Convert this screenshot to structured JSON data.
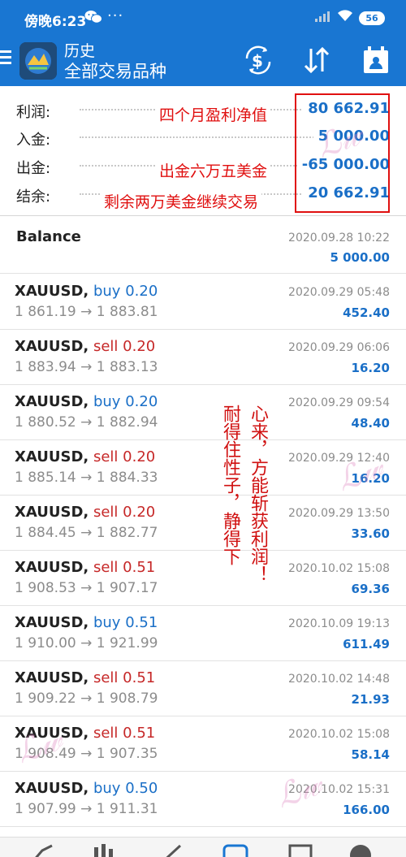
{
  "status_bar": {
    "time": "傍晚6:23",
    "dots": "···",
    "battery": "56"
  },
  "app_bar": {
    "title": "历史",
    "subtitle": "全部交易品种"
  },
  "summary": [
    {
      "label": "利润:",
      "value": "80 662.91"
    },
    {
      "label": "入金:",
      "value": "5 000.00"
    },
    {
      "label": "出金:",
      "value": "-65 000.00"
    },
    {
      "label": "结余:",
      "value": "20 662.91"
    }
  ],
  "annotations": {
    "profit_note": "四个月盈利净值",
    "withdraw_note": "出金六万五美金",
    "balance_note": "剩余两万美金继续交易",
    "vertical_right": "心来，方能斩获利润！",
    "vertical_left": "耐得住性子，静得下",
    "accent_color": "#e01010"
  },
  "balance": {
    "label": "Balance",
    "time": "2020.09.28 10:22",
    "amount": "5 000.00"
  },
  "deals": [
    {
      "symbol": "XAUUSD,",
      "direction": "buy",
      "volume": "0.20",
      "prices": "1 861.19 → 1 883.81",
      "time": "2020.09.29 05:48",
      "profit": "452.40"
    },
    {
      "symbol": "XAUUSD,",
      "direction": "sell",
      "volume": "0.20",
      "prices": "1 883.94 → 1 883.13",
      "time": "2020.09.29 06:06",
      "profit": "16.20"
    },
    {
      "symbol": "XAUUSD,",
      "direction": "buy",
      "volume": "0.20",
      "prices": "1 880.52 → 1 882.94",
      "time": "2020.09.29 09:54",
      "profit": "48.40"
    },
    {
      "symbol": "XAUUSD,",
      "direction": "sell",
      "volume": "0.20",
      "prices": "1 885.14 → 1 884.33",
      "time": "2020.09.29 12:40",
      "profit": "16.20"
    },
    {
      "symbol": "XAUUSD,",
      "direction": "sell",
      "volume": "0.20",
      "prices": "1 884.45 → 1 882.77",
      "time": "2020.09.29 13:50",
      "profit": "33.60"
    },
    {
      "symbol": "XAUUSD,",
      "direction": "sell",
      "volume": "0.51",
      "prices": "1 908.53 → 1 907.17",
      "time": "2020.10.02 15:08",
      "profit": "69.36"
    },
    {
      "symbol": "XAUUSD,",
      "direction": "buy",
      "volume": "0.51",
      "prices": "1 910.00 → 1 921.99",
      "time": "2020.10.09 19:13",
      "profit": "611.49"
    },
    {
      "symbol": "XAUUSD,",
      "direction": "sell",
      "volume": "0.51",
      "prices": "1 909.22 → 1 908.79",
      "time": "2020.10.02 14:48",
      "profit": "21.93"
    },
    {
      "symbol": "XAUUSD,",
      "direction": "sell",
      "volume": "0.51",
      "prices": "1 908.49 → 1 907.35",
      "time": "2020.10.02 15:08",
      "profit": "58.14"
    },
    {
      "symbol": "XAUUSD,",
      "direction": "buy",
      "volume": "0.50",
      "prices": "1 907.99 → 1 911.31",
      "time": "2020.10.02 15:31",
      "profit": "166.00"
    }
  ],
  "colors": {
    "primary": "#1976d2",
    "value_blue": "#1a6fc7",
    "sell_red": "#c62828"
  },
  "icons": {
    "menu": "menu-icon",
    "logo": "metatrader-logo",
    "currency": "currency-exchange-icon",
    "sort": "sort-icon",
    "calendar": "calendar-person-icon"
  }
}
